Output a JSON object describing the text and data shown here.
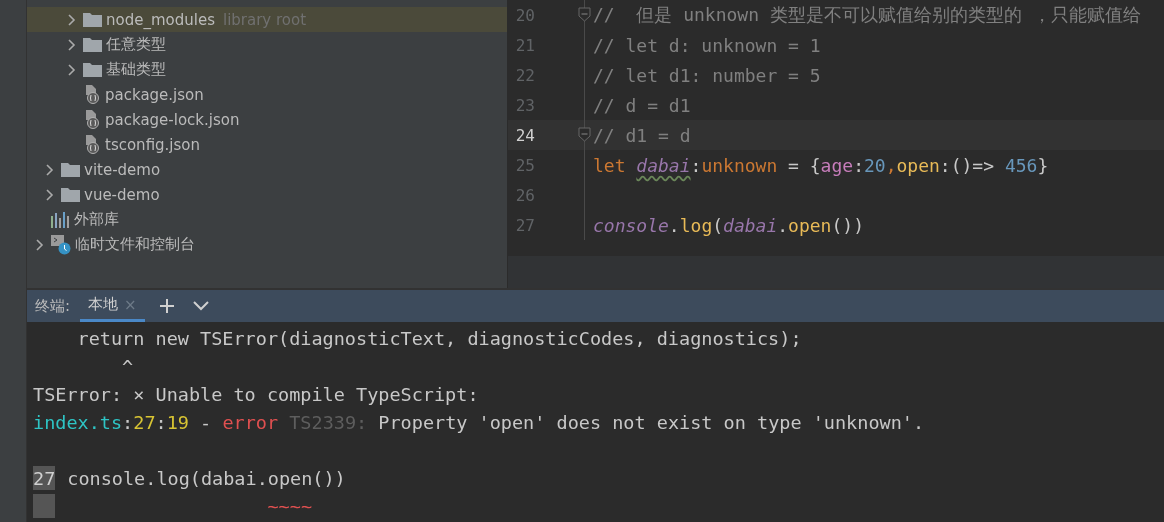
{
  "project_tree": [
    {
      "children": [
        {
          "children": [
            {
              "label": "node_modules",
              "kind": "folder",
              "expanded": false,
              "selected": true,
              "note": "library root"
            },
            {
              "label": "任意类型",
              "kind": "folder",
              "expanded": false,
              "selected": false
            },
            {
              "label": "基础类型",
              "kind": "folder",
              "expanded": false,
              "selected": false
            },
            {
              "label": "package.json",
              "kind": "json",
              "selected": false
            },
            {
              "label": "package-lock.json",
              "kind": "json",
              "selected": false
            },
            {
              "label": "tsconfig.json",
              "kind": "json",
              "selected": false
            }
          ]
        },
        {
          "label": "vite-demo",
          "kind": "folder",
          "expanded": false,
          "selected": false
        },
        {
          "label": "vue-demo",
          "kind": "folder",
          "expanded": false,
          "selected": false
        }
      ]
    },
    {
      "label": "外部库",
      "kind": "library",
      "selected": false
    },
    {
      "label": "临时文件和控制台",
      "kind": "scratch",
      "expanded": false,
      "selected": false
    }
  ],
  "editor": {
    "lines": [
      {
        "number": "20",
        "fold": true,
        "current": false,
        "tokens": [
          {
            "text": "//  但是 unknown 类型是不可以赋值给别的类型的 ，只能赋值给",
            "kind": "comment"
          }
        ]
      },
      {
        "number": "21",
        "fold": false,
        "current": false,
        "tokens": [
          {
            "text": "// let d: unknown = 1",
            "kind": "comment"
          }
        ]
      },
      {
        "number": "22",
        "fold": false,
        "current": false,
        "tokens": [
          {
            "text": "// let d1: number = 5",
            "kind": "comment"
          }
        ]
      },
      {
        "number": "23",
        "fold": false,
        "current": false,
        "tokens": [
          {
            "text": "// d = d1",
            "kind": "comment"
          }
        ]
      },
      {
        "number": "24",
        "fold": true,
        "current": true,
        "tokens": [
          {
            "text": "// d1 = d",
            "kind": "comment"
          }
        ]
      },
      {
        "number": "25",
        "fold": false,
        "current": false,
        "tokens": [
          {
            "text": "let ",
            "kind": "keyword"
          },
          {
            "text": "dabai",
            "kind": "warning"
          },
          {
            "text": ":",
            "kind": "punct"
          },
          {
            "text": "unknown",
            "kind": "keyword"
          },
          {
            "text": " = {",
            "kind": "punct"
          },
          {
            "text": "age",
            "kind": "prop"
          },
          {
            "text": ":",
            "kind": "punct"
          },
          {
            "text": "20",
            "kind": "number"
          },
          {
            "text": ",",
            "kind": "keyword"
          },
          {
            "text": "open",
            "kind": "func"
          },
          {
            "text": ":()=> ",
            "kind": "punct"
          },
          {
            "text": "456",
            "kind": "number"
          },
          {
            "text": "}",
            "kind": "punct"
          }
        ]
      },
      {
        "number": "26",
        "fold": false,
        "current": false
      },
      {
        "number": "27",
        "fold": false,
        "current": false,
        "tokens": [
          {
            "text": "console",
            "kind": "global"
          },
          {
            "text": ".",
            "kind": "punct"
          },
          {
            "text": "log",
            "kind": "func"
          },
          {
            "text": "(",
            "kind": "punct"
          },
          {
            "text": "dabai",
            "kind": "variable"
          },
          {
            "text": ".",
            "kind": "punct"
          },
          {
            "text": "open",
            "kind": "func"
          },
          {
            "text": "())",
            "kind": "punct"
          }
        ]
      }
    ]
  },
  "terminal": {
    "title": "终端:",
    "tabs": [
      {
        "label": "本地",
        "selected": true,
        "close": "×"
      }
    ],
    "lines": [
      {
        "kind": "text",
        "tokens": [
          {
            "text": "    return new TSError(diagnosticText, diagnosticCodes, diagnostics);",
            "kind": "plain"
          }
        ]
      },
      {
        "kind": "text",
        "tokens": [
          {
            "text": "        ^",
            "kind": "plain"
          }
        ]
      },
      {
        "kind": "text",
        "tokens": [
          {
            "text": "TSError: × Unable to compile TypeScript:",
            "kind": "plain"
          }
        ]
      },
      {
        "kind": "text",
        "tokens": [
          {
            "text": "index.ts",
            "kind": "path"
          },
          {
            "text": ":",
            "kind": "plain"
          },
          {
            "text": "27",
            "kind": "position"
          },
          {
            "text": ":",
            "kind": "plain"
          },
          {
            "text": "19",
            "kind": "position"
          },
          {
            "text": " - ",
            "kind": "plain"
          },
          {
            "text": "error",
            "kind": "error"
          },
          {
            "text": " TS2339:",
            "kind": "dim"
          },
          {
            "text": " Property 'open' does not exist on type 'unknown'.",
            "kind": "plain"
          }
        ]
      },
      {
        "kind": "blank"
      },
      {
        "kind": "source",
        "gutter": "27",
        "tokens": [
          {
            "text": "console.log(dabai.open())",
            "kind": "plain"
          }
        ]
      },
      {
        "kind": "marker",
        "tokens": [
          {
            "text": "                  ~~~~",
            "kind": "squiggle"
          }
        ]
      }
    ]
  }
}
